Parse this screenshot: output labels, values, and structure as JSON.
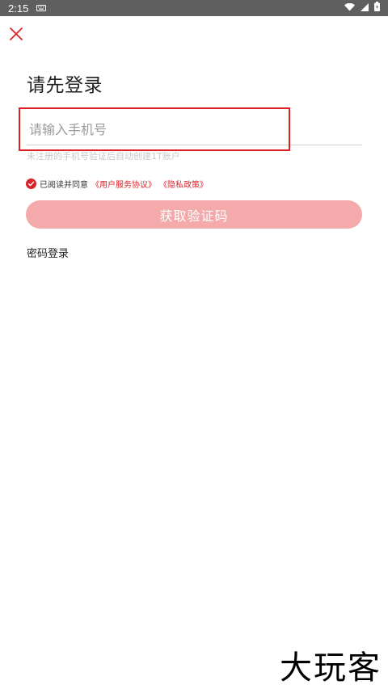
{
  "status_bar": {
    "time": "2:15",
    "icons": [
      "keyboard-icon",
      "wifi-icon",
      "signal-icon",
      "battery-icon"
    ]
  },
  "header": {
    "close_icon": "close-icon",
    "title": "请先登录"
  },
  "phone": {
    "placeholder": "请输入手机号",
    "value": "",
    "hint": "未注册的手机号验证后自动创建1T账户"
  },
  "agreement": {
    "checked": true,
    "prefix": "已阅读并同意",
    "user_agreement": "《用户服务协议》",
    "privacy_policy": "《隐私政策》"
  },
  "actions": {
    "get_code_label": "获取验证码",
    "password_login_label": "密码登录"
  },
  "watermark": {
    "text": "大玩客"
  },
  "colors": {
    "accent": "#d9242a",
    "button_disabled": "#f4aaaa",
    "status_bar": "#5f5f5f",
    "highlight": "#e02020"
  }
}
